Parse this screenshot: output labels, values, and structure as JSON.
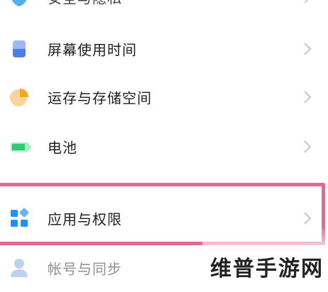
{
  "settings_list": {
    "items": [
      {
        "key": "top-partial",
        "label": "安全与隐私"
      },
      {
        "key": "screen-time",
        "label": "屏幕使用时间"
      },
      {
        "key": "storage",
        "label": "运存与存储空间"
      },
      {
        "key": "battery",
        "label": "电池"
      },
      {
        "key": "apps",
        "label": "应用与权限"
      },
      {
        "key": "account",
        "label": "帐号与同步"
      }
    ]
  },
  "colors": {
    "highlight": "#e5688f",
    "screen_time_icon": "#4e7de8",
    "storage_icon": "#f5a623",
    "battery_icon": "#2ecc71",
    "apps_icon": "#1e90ff",
    "account_icon": "#7ba7e6"
  },
  "watermark": {
    "text": "维普手游网"
  }
}
